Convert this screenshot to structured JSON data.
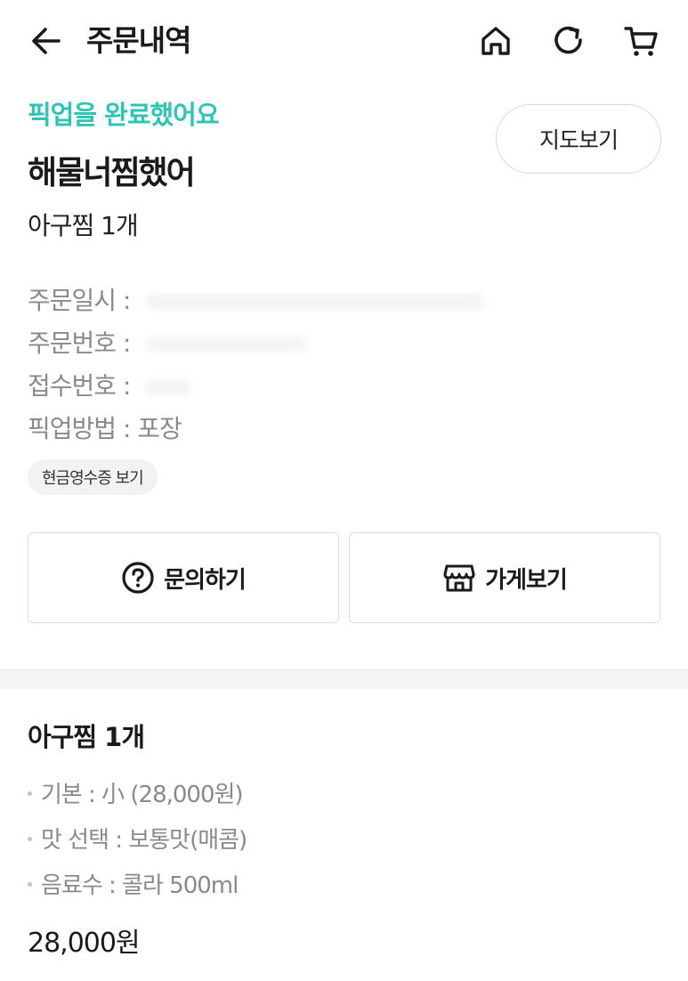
{
  "header": {
    "title": "주문내역",
    "icons": [
      "arrow-left-icon",
      "home-icon",
      "refresh-icon",
      "cart-icon"
    ]
  },
  "order": {
    "status": "픽업을 완료했어요",
    "map_button": "지도보기",
    "store_name": "해물너찜했어",
    "summary": "아구찜 1개",
    "info": {
      "order_date_label": "주문일시 :",
      "order_number_label": "주문번호 :",
      "receipt_number_label": "접수번호 :",
      "pickup_method_label": "픽업방법 :",
      "pickup_method_value": "포장"
    },
    "receipt_chip": "현금영수증 보기",
    "inquiry_button": "문의하기",
    "store_button": "가게보기"
  },
  "menu": {
    "title": "아구찜 1개",
    "options": [
      {
        "text": "기본 : 小 (28,000원)"
      },
      {
        "text": "맛 선택 : 보통맛(매콤)"
      },
      {
        "text": "음료수 : 콜라 500ml"
      }
    ],
    "price": "28,000원"
  },
  "colors": {
    "accent": "#2ec4b6",
    "muted_text": "#8a8a8a",
    "border": "#dcdcdc",
    "divider": "#f4f5f6"
  }
}
